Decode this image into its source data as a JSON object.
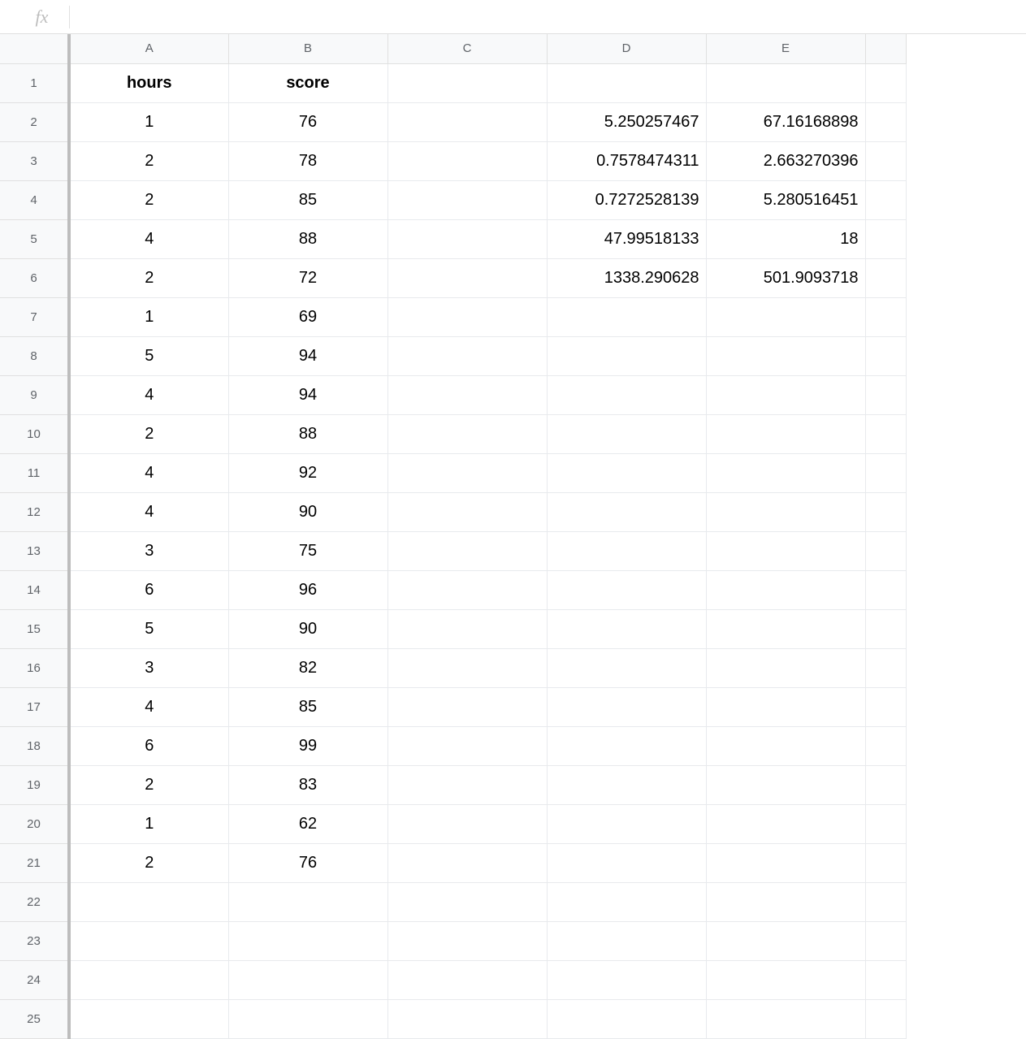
{
  "formula_bar": {
    "fx_label": "fx",
    "value": ""
  },
  "columns": [
    "A",
    "B",
    "C",
    "D",
    "E",
    ""
  ],
  "rows": [
    "1",
    "2",
    "3",
    "4",
    "5",
    "6",
    "7",
    "8",
    "9",
    "10",
    "11",
    "12",
    "13",
    "14",
    "15",
    "16",
    "17",
    "18",
    "19",
    "20",
    "21",
    "22",
    "23",
    "24",
    "25"
  ],
  "headers": {
    "A": "hours",
    "B": "score"
  },
  "data": {
    "A": [
      "1",
      "2",
      "2",
      "4",
      "2",
      "1",
      "5",
      "4",
      "2",
      "4",
      "4",
      "3",
      "6",
      "5",
      "3",
      "4",
      "6",
      "2",
      "1",
      "2"
    ],
    "B": [
      "76",
      "78",
      "85",
      "88",
      "72",
      "69",
      "94",
      "94",
      "88",
      "92",
      "90",
      "75",
      "96",
      "90",
      "82",
      "85",
      "99",
      "83",
      "62",
      "76"
    ],
    "D": [
      "5.250257467",
      "0.7578474311",
      "0.7272528139",
      "47.99518133",
      "1338.290628"
    ],
    "E": [
      "67.16168898",
      "2.663270396",
      "5.280516451",
      "18",
      "501.9093718"
    ]
  }
}
